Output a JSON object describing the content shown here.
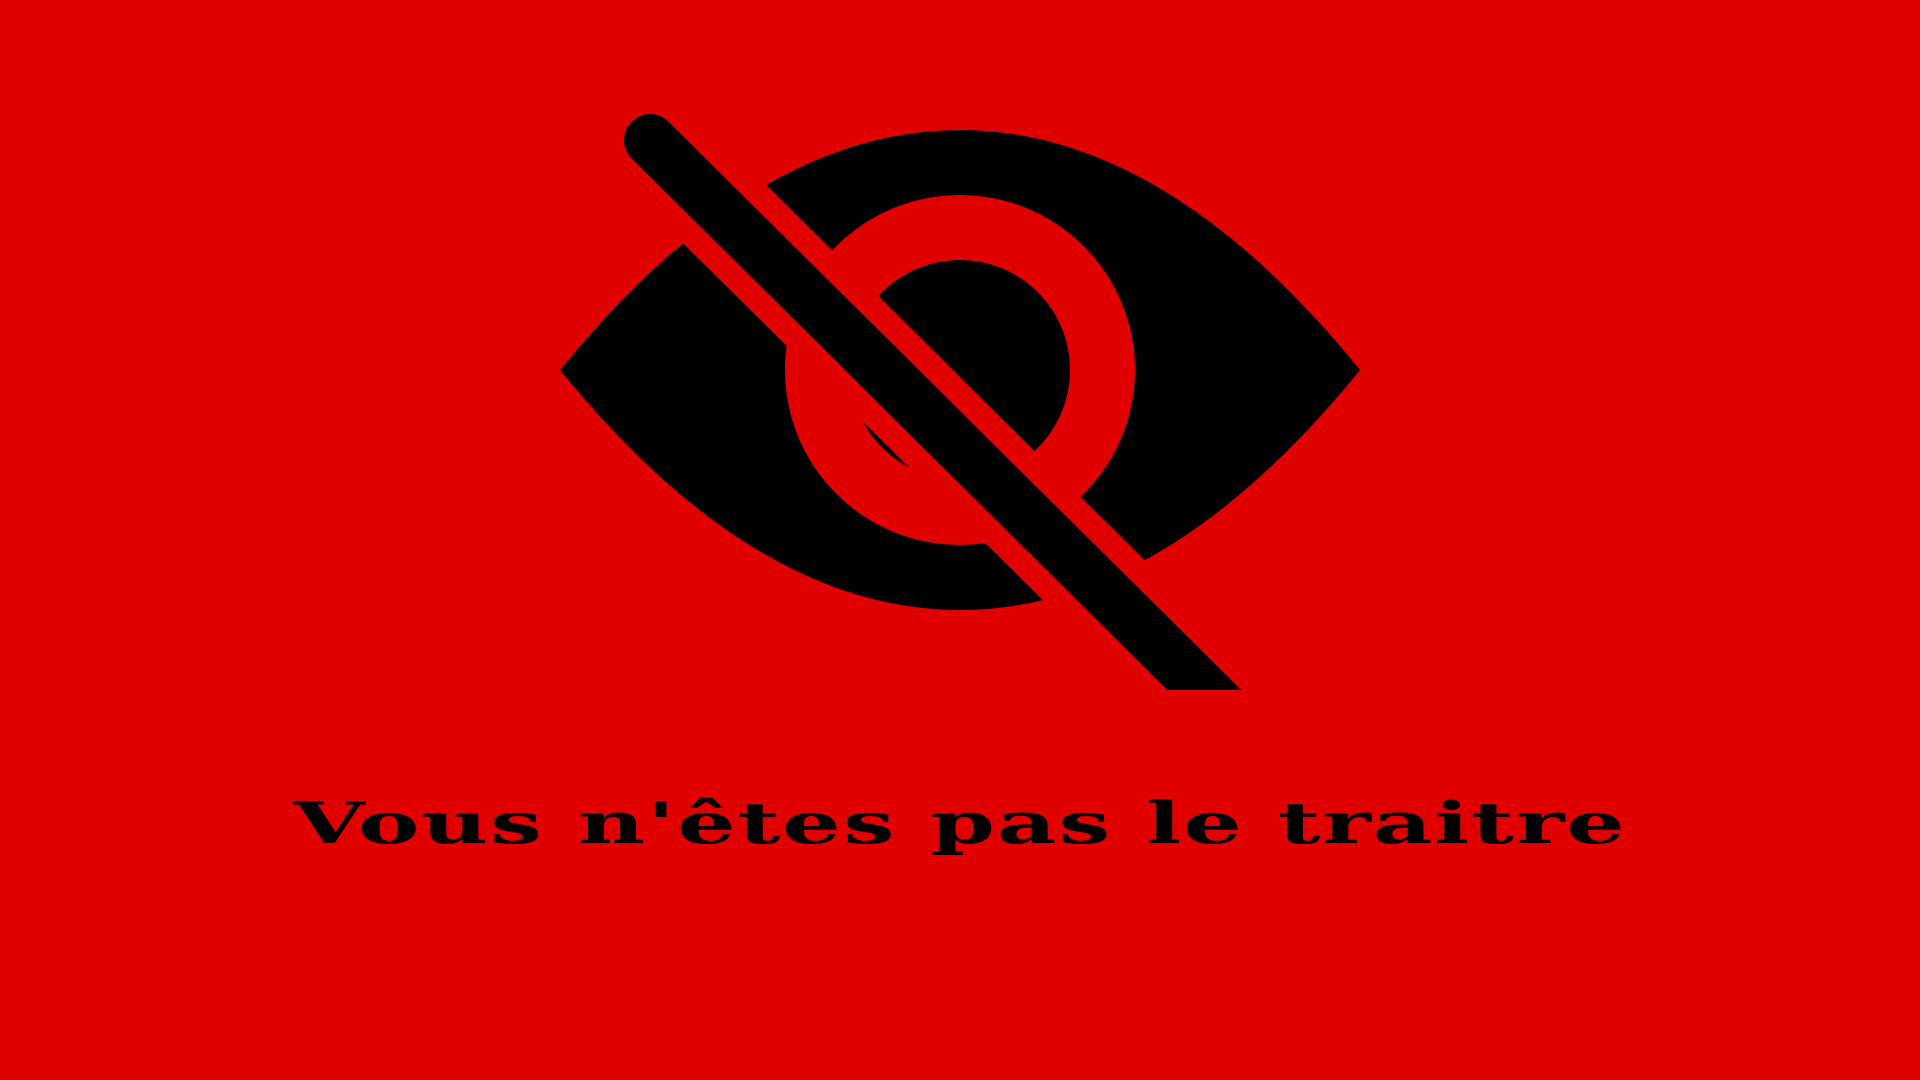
{
  "background_color": "#e00000",
  "foreground_color": "#000000",
  "icon": "eye-slash-icon",
  "message": "Vous n'êtes pas le traitre"
}
